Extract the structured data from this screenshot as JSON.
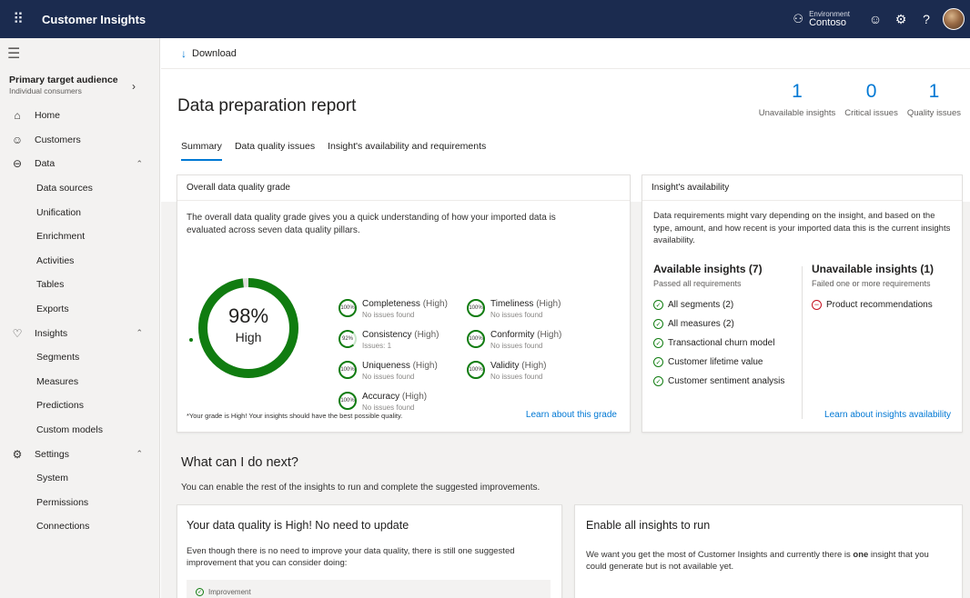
{
  "app": {
    "name": "Customer Insights"
  },
  "topbar": {
    "env_label": "Environment",
    "env_value": "Contoso"
  },
  "sidebar": {
    "audience_title": "Primary target audience",
    "audience_sub": "Individual consumers",
    "items": [
      {
        "label": "Home",
        "icon": "home-icon",
        "glyph": "⌂",
        "sub": false
      },
      {
        "label": "Customers",
        "icon": "customers-icon",
        "glyph": "☺",
        "sub": false
      },
      {
        "label": "Data",
        "icon": "database-icon",
        "glyph": "⊖",
        "sub": false,
        "caret": "⌃"
      },
      {
        "label": "Data sources",
        "sub": true
      },
      {
        "label": "Unification",
        "sub": true
      },
      {
        "label": "Enrichment",
        "sub": true
      },
      {
        "label": "Activities",
        "sub": true
      },
      {
        "label": "Tables",
        "sub": true
      },
      {
        "label": "Exports",
        "sub": true
      },
      {
        "label": "Insights",
        "icon": "lightbulb-icon",
        "glyph": "♡",
        "sub": false,
        "caret": "⌃"
      },
      {
        "label": "Segments",
        "sub": true
      },
      {
        "label": "Measures",
        "sub": true
      },
      {
        "label": "Predictions",
        "sub": true
      },
      {
        "label": "Custom models",
        "sub": true
      },
      {
        "label": "Settings",
        "icon": "gear-icon",
        "glyph": "⚙",
        "sub": false,
        "caret": "⌃"
      },
      {
        "label": "System",
        "sub": true
      },
      {
        "label": "Permissions",
        "sub": true
      },
      {
        "label": "Connections",
        "sub": true
      }
    ]
  },
  "command": {
    "download": "Download"
  },
  "page": {
    "title": "Data preparation report",
    "stats": [
      {
        "value": "1",
        "label": "Unavailable insights"
      },
      {
        "value": "0",
        "label": "Critical issues"
      },
      {
        "value": "1",
        "label": "Quality issues"
      }
    ],
    "tabs": [
      "Summary",
      "Data quality issues",
      "Insight's availability and requirements"
    ]
  },
  "quality": {
    "heading": "Overall data quality grade",
    "description": "The overall data quality grade gives you a quick understanding of how your imported data is evaluated across seven data quality pillars.",
    "grade_value": "98%",
    "grade_fraction": 0.98,
    "grade_label": "High",
    "pillars": [
      {
        "name": "Completeness",
        "level": "(High)",
        "status": "No issues found",
        "pct": "100%"
      },
      {
        "name": "Timeliness",
        "level": "(High)",
        "status": "No issues found",
        "pct": "100%"
      },
      {
        "name": "Consistency",
        "level": "(High)",
        "status": "Issues: 1",
        "pct": "92%"
      },
      {
        "name": "Conformity",
        "level": "(High)",
        "status": "No issues found",
        "pct": "100%"
      },
      {
        "name": "Uniqueness",
        "level": "(High)",
        "status": "No issues found",
        "pct": "100%"
      },
      {
        "name": "Validity",
        "level": "(High)",
        "status": "No issues found",
        "pct": "100%"
      },
      {
        "name": "Accuracy",
        "level": "(High)",
        "status": "No issues found",
        "pct": "100%"
      }
    ],
    "footnote": "*Your grade is High! Your insights should have the best possible quality.",
    "learn_link": "Learn about this grade"
  },
  "availability": {
    "heading": "Insight's availability",
    "description": "Data requirements might vary depending on the insight, and based on the type, amount, and how recent is your imported data this is the current insights availability.",
    "available_title": "Available insights (7)",
    "available_sub": "Passed all requirements",
    "available_items": [
      "All segments (2)",
      "All measures (2)",
      "Transactional churn model",
      "Customer lifetime value",
      "Customer sentiment analysis"
    ],
    "unavailable_title": "Unavailable insights (1)",
    "unavailable_sub": "Failed one or more requirements",
    "unavailable_items": [
      "Product recommendations"
    ],
    "learn_link": "Learn about insights availability"
  },
  "next": {
    "title": "What can I do next?",
    "subtitle": "You can enable the rest of the insights to run and complete the suggested improvements.",
    "quality_card_title": "Your data quality is High! No need to update",
    "quality_card_text": "Even though there is no need to improve your data quality, there is still one suggested improvement that you can consider doing:",
    "improvement_label": "Improvement",
    "enable_card_title": "Enable all insights to run",
    "enable_card_text_a": "We want you get the most of Customer Insights and currently there is ",
    "enable_card_text_bold": "one",
    "enable_card_text_b": " insight that you could generate but is not available yet."
  }
}
